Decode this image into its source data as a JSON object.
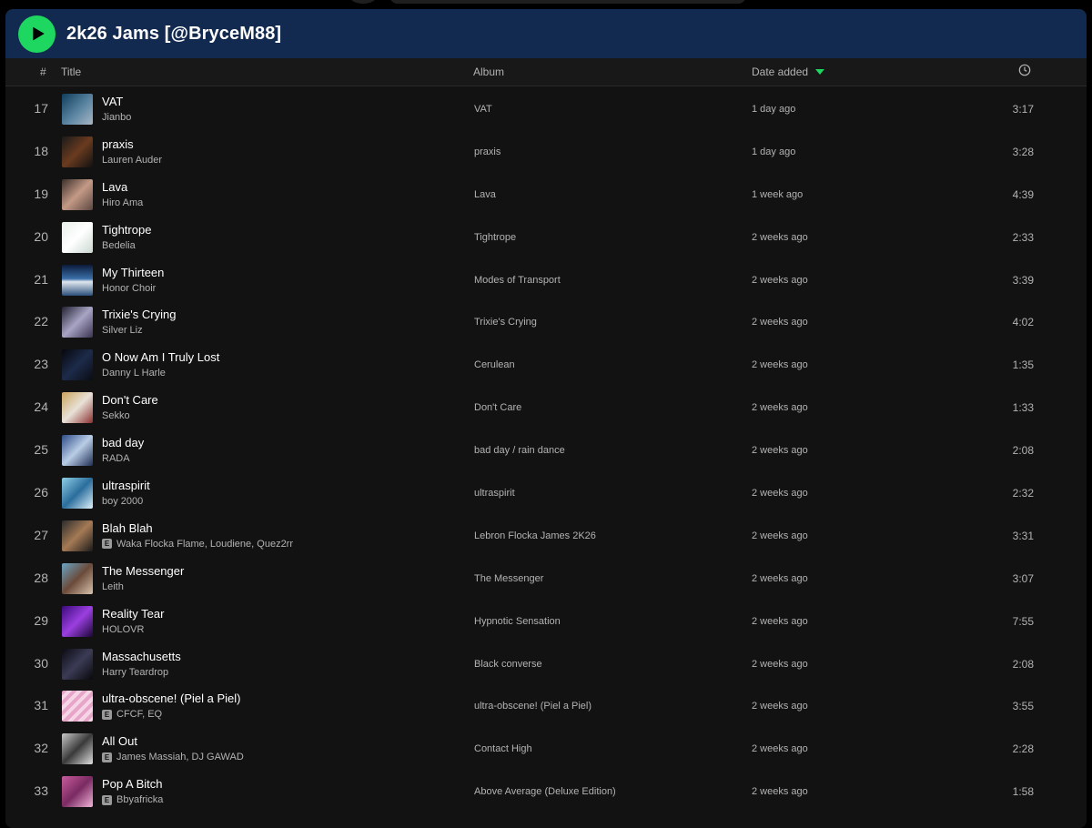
{
  "playlist": {
    "title": "2k26 Jams [@BryceM88]"
  },
  "columns": {
    "number": "#",
    "title": "Title",
    "album": "Album",
    "date_added": "Date added",
    "duration_icon": "clock-icon"
  },
  "colors": {
    "accent": "#1ed760",
    "header_bg": "#122a4f",
    "panel_bg": "#121212"
  },
  "tracks": [
    {
      "num": "17",
      "title": "VAT",
      "artist": "Jianbo",
      "explicit": false,
      "album": "VAT",
      "date_added": "1 day ago",
      "duration": "3:17"
    },
    {
      "num": "18",
      "title": "praxis",
      "artist": "Lauren Auder",
      "explicit": false,
      "album": "praxis",
      "date_added": "1 day ago",
      "duration": "3:28"
    },
    {
      "num": "19",
      "title": "Lava",
      "artist": "Hiro Ama",
      "explicit": false,
      "album": "Lava",
      "date_added": "1 week ago",
      "duration": "4:39"
    },
    {
      "num": "20",
      "title": "Tightrope",
      "artist": "Bedelia",
      "explicit": false,
      "album": "Tightrope",
      "date_added": "2 weeks ago",
      "duration": "2:33"
    },
    {
      "num": "21",
      "title": "My Thirteen",
      "artist": "Honor Choir",
      "explicit": false,
      "album": "Modes of Transport",
      "date_added": "2 weeks ago",
      "duration": "3:39"
    },
    {
      "num": "22",
      "title": "Trixie's Crying",
      "artist": "Silver Liz",
      "explicit": false,
      "album": "Trixie's Crying",
      "date_added": "2 weeks ago",
      "duration": "4:02"
    },
    {
      "num": "23",
      "title": "O Now Am I Truly Lost",
      "artist": "Danny L Harle",
      "explicit": false,
      "album": "Cerulean",
      "date_added": "2 weeks ago",
      "duration": "1:35"
    },
    {
      "num": "24",
      "title": "Don't Care",
      "artist": "Sekko",
      "explicit": false,
      "album": "Don't Care",
      "date_added": "2 weeks ago",
      "duration": "1:33"
    },
    {
      "num": "25",
      "title": "bad day",
      "artist": "RADA",
      "explicit": false,
      "album": "bad day / rain dance",
      "date_added": "2 weeks ago",
      "duration": "2:08"
    },
    {
      "num": "26",
      "title": "ultraspirit",
      "artist": "boy 2000",
      "explicit": false,
      "album": "ultraspirit",
      "date_added": "2 weeks ago",
      "duration": "2:32"
    },
    {
      "num": "27",
      "title": "Blah Blah",
      "artist": "Waka Flocka Flame, Loudiene, Quez2rr",
      "explicit": true,
      "album": "Lebron Flocka James 2K26",
      "date_added": "2 weeks ago",
      "duration": "3:31"
    },
    {
      "num": "28",
      "title": "The Messenger",
      "artist": "Leith",
      "explicit": false,
      "album": "The Messenger",
      "date_added": "2 weeks ago",
      "duration": "3:07"
    },
    {
      "num": "29",
      "title": "Reality Tear",
      "artist": "HOLOVR",
      "explicit": false,
      "album": "Hypnotic Sensation",
      "date_added": "2 weeks ago",
      "duration": "7:55"
    },
    {
      "num": "30",
      "title": "Massachusetts",
      "artist": "Harry Teardrop",
      "explicit": false,
      "album": "Black converse",
      "date_added": "2 weeks ago",
      "duration": "2:08"
    },
    {
      "num": "31",
      "title": "ultra-obscene! (Piel a Piel)",
      "artist": "CFCF, EQ",
      "explicit": true,
      "album": "ultra-obscene! (Piel a Piel)",
      "date_added": "2 weeks ago",
      "duration": "3:55"
    },
    {
      "num": "32",
      "title": "All Out",
      "artist": "James Massiah, DJ GAWAD",
      "explicit": true,
      "album": "Contact High",
      "date_added": "2 weeks ago",
      "duration": "2:28"
    },
    {
      "num": "33",
      "title": "Pop A Bitch",
      "artist": "Bbyafricka",
      "explicit": true,
      "album": "Above Average (Deluxe Edition)",
      "date_added": "2 weeks ago",
      "duration": "1:58"
    }
  ],
  "explicit_label": "E"
}
